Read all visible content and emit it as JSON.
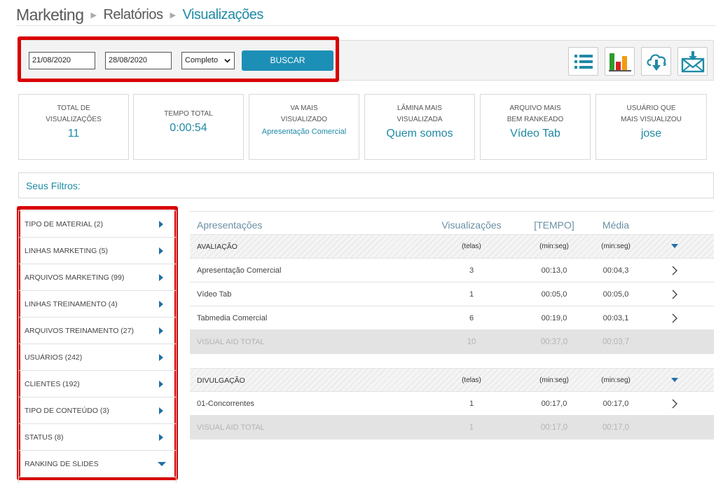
{
  "breadcrumb": {
    "root": "Marketing",
    "middle": "Relatórios",
    "current": "Visualizações"
  },
  "filters": {
    "date_start": "21/08/2020",
    "date_end": "28/08/2020",
    "mode_selected": "Completo",
    "search_label": "BUSCAR"
  },
  "toolbar": {
    "icons": [
      "list-icon",
      "bar-chart-icon",
      "cloud-download-icon",
      "email-icon"
    ]
  },
  "stats": [
    {
      "title1": "TOTAL DE",
      "title2": "VISUALIZAÇÕES",
      "value": "11"
    },
    {
      "title1": "TEMPO TOTAL",
      "title2": "",
      "value": "0:00:54"
    },
    {
      "title1": "VA MAIS",
      "title2": "VISUALIZADO",
      "value": "Apresentação Comercial"
    },
    {
      "title1": "LÂMINA MAIS",
      "title2": "VISUALIZADA",
      "value": "Quem somos"
    },
    {
      "title1": "ARQUIVO MAIS",
      "title2": "BEM RANKEADO",
      "value": "Vídeo Tab"
    },
    {
      "title1": "USUÁRIO QUE",
      "title2": "MAIS VISUALIZOU",
      "value": "jose"
    }
  ],
  "seus_filtros": "Seus Filtros:",
  "sidebar": {
    "items": [
      {
        "label": "TIPO DE MATERIAL (2)"
      },
      {
        "label": "LINHAS MARKETING (5)"
      },
      {
        "label": "ARQUIVOS MARKETING (99)"
      },
      {
        "label": "LINHAS TREINAMENTO (4)"
      },
      {
        "label": "ARQUIVOS TREINAMENTO (27)"
      },
      {
        "label": "USUÁRIOS (242)"
      },
      {
        "label": "CLIENTES (192)"
      },
      {
        "label": "TIPO DE CONTEÚDO (3)"
      },
      {
        "label": "STATUS (8)"
      },
      {
        "label": "RANKING DE SLIDES"
      }
    ]
  },
  "table": {
    "headers": {
      "name": "Apresentações",
      "views": "Visualizações",
      "tempo": "[TEMPO]",
      "media": "Média"
    },
    "groups": [
      {
        "name": "AVALIAÇÃO",
        "units": {
          "views": "(telas)",
          "tempo": "(min:seg)",
          "media": "(min:seg)"
        },
        "rows": [
          {
            "name": "Apresentação Comercial",
            "views": "3",
            "tempo": "00:13,0",
            "media": "00:04,3"
          },
          {
            "name": "Vídeo Tab",
            "views": "1",
            "tempo": "00:05,0",
            "media": "00:05,0"
          },
          {
            "name": "Tabmedia Comercial",
            "views": "6",
            "tempo": "00:19,0",
            "media": "00:03,1"
          }
        ],
        "total": {
          "label": "VISUAL AID TOTAL",
          "views": "10",
          "tempo": "00:37,0",
          "media": "00:03,7"
        }
      },
      {
        "name": "DIVULGAÇÃO",
        "units": {
          "views": "(telas)",
          "tempo": "(min:seg)",
          "media": "(min:seg)"
        },
        "rows": [
          {
            "name": "01-Concorrentes",
            "views": "1",
            "tempo": "00:17,0",
            "media": "00:17,0"
          }
        ],
        "total": {
          "label": "VISUAL AID TOTAL",
          "views": "1",
          "tempo": "00:17,0",
          "media": "00:17,0"
        }
      }
    ]
  },
  "colors": {
    "accent": "#1f8aa6",
    "highlight": "#d90000",
    "button": "#1c8fb6"
  }
}
